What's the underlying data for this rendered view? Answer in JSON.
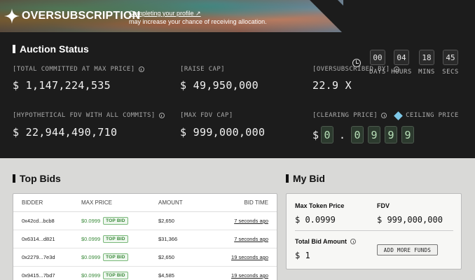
{
  "banner": {
    "brand": "OVERSUBSCRIPTION",
    "note_link": "Completing your profile ↗",
    "note_text": "may increase your chance of receiving allocation."
  },
  "countdown": [
    {
      "value": "00",
      "label": "DAYS"
    },
    {
      "value": "04",
      "label": "HOURS"
    },
    {
      "value": "18",
      "label": "MINS"
    },
    {
      "value": "45",
      "label": "SECS"
    }
  ],
  "auction": {
    "title": "Auction Status",
    "total_committed_label": "[TOTAL COMMITTED AT MAX PRICE]",
    "total_committed_value": "$ 1,147,224,535",
    "raise_cap_label": "[RAISE CAP]",
    "raise_cap_value": "$ 49,950,000",
    "oversubscribed_label": "[OVERSUBSCRIBED BY]",
    "oversubscribed_value": "22.9 X",
    "hypo_fdv_label": "[HYPOTHETICAL FDV WITH ALL COMMITS]",
    "hypo_fdv_value": "$ 22,944,490,710",
    "max_fdv_label": "[MAX FDV CAP]",
    "max_fdv_value": "$ 999,000,000",
    "clearing_label": "[CLEARING PRICE]",
    "ceiling_label": "CEILING PRICE",
    "clearing_dollar": "$",
    "clearing_digits": [
      "0",
      ".",
      "0",
      "9",
      "9",
      "9"
    ]
  },
  "top_bids": {
    "title": "Top Bids",
    "columns": [
      "BIDDER",
      "MAX PRICE",
      "AMOUNT",
      "BID TIME"
    ],
    "rows": [
      {
        "bidder": "0x42cd...bcb8",
        "price": "$0.0999",
        "tag": "TOP BID",
        "amount": "$2,650",
        "time": "7 seconds ago"
      },
      {
        "bidder": "0x6314...d821",
        "price": "$0.0999",
        "tag": "TOP BID",
        "amount": "$31,366",
        "time": "7 seconds ago"
      },
      {
        "bidder": "0x2279...7e3d",
        "price": "$0.0999",
        "tag": "TOP BID",
        "amount": "$2,650",
        "time": "19 seconds ago"
      },
      {
        "bidder": "0x9415...7bd7",
        "price": "$0.0999",
        "tag": "TOP BID",
        "amount": "$4,585",
        "time": "19 seconds ago"
      }
    ]
  },
  "my_bid": {
    "title": "My Bid",
    "max_token_label": "Max Token Price",
    "max_token_value": "$ 0.0999",
    "fdv_label": "FDV",
    "fdv_value": "$ 999,000,000",
    "total_label": "Total Bid Amount",
    "total_value": "$ 1",
    "add_funds_label": "ADD MORE FUNDS"
  },
  "colors": {
    "dark_bg": "#1c1c1c",
    "light_bg": "#d9d9d7",
    "accent_green": "#3a8a3a"
  }
}
